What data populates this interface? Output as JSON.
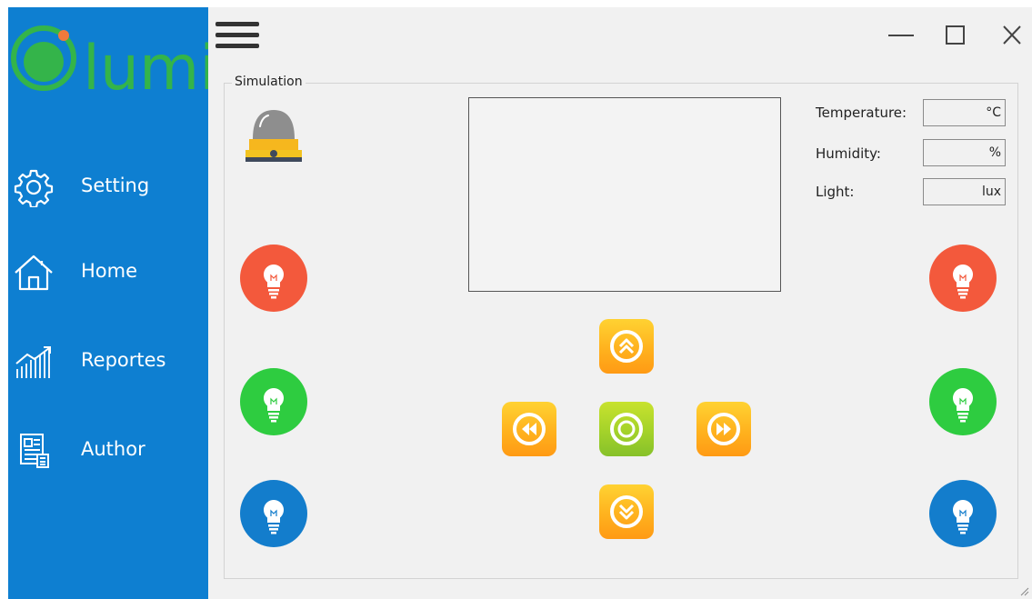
{
  "app": {
    "logo_text": "lumi",
    "accent_blue": "#0e7fd1",
    "logo_green": "#34b44a",
    "logo_dot": "#f07a3c"
  },
  "sidebar": {
    "items": [
      {
        "label": "Setting",
        "icon": "gear-icon"
      },
      {
        "label": "Home",
        "icon": "home-icon"
      },
      {
        "label": "Reportes",
        "icon": "chart-icon"
      },
      {
        "label": "Author",
        "icon": "author-icon"
      }
    ]
  },
  "window_controls": {
    "minimize": "minimize-icon",
    "maximize": "maximize-icon",
    "close": "close-icon"
  },
  "simulation": {
    "title": "Simulation",
    "sensors": {
      "temperature": {
        "label": "Temperature:",
        "value": "",
        "unit": "°C"
      },
      "humidity": {
        "label": "Humidity:",
        "value": "",
        "unit": "%"
      },
      "light": {
        "label": "Light:",
        "value": "",
        "unit": "lux"
      }
    },
    "bulb_colors": {
      "red": "#f3593c",
      "green": "#2ecc40",
      "blue": "#137dcc"
    },
    "controls": {
      "up": "chevron-up-icon",
      "down": "chevron-down-icon",
      "left": "rewind-icon",
      "right": "fast-forward-icon",
      "center": "record-icon"
    }
  }
}
